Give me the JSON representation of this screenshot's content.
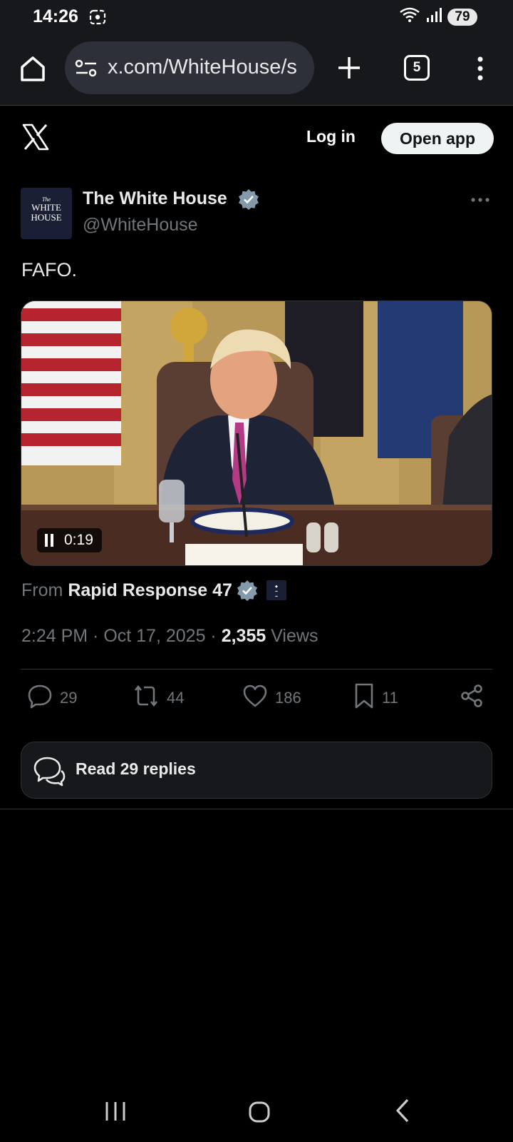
{
  "status_bar": {
    "time": "14:26",
    "battery": "79",
    "icons": [
      "screen-recorder-icon",
      "wifi-icon",
      "signal-icon"
    ]
  },
  "browser": {
    "url": "x.com/WhiteHouse/s",
    "tab_count": "5",
    "icons": [
      "home-icon",
      "site-settings-icon",
      "new-tab-icon",
      "tabs-icon",
      "overflow-menu-icon"
    ]
  },
  "header": {
    "login": "Log in",
    "open_app": "Open app"
  },
  "tweet": {
    "author_name": "The White House",
    "author_handle": "@WhiteHouse",
    "avatar_lines": [
      "The",
      "WHITE",
      "HOUSE"
    ],
    "text": "FAFO.",
    "video": {
      "time": "0:19",
      "state": "playing"
    },
    "from_label": "From",
    "from_source": "Rapid Response 47",
    "timestamp": "2:24 PM · Oct 17, 2025 · ",
    "views_count": "2,355",
    "views_label": " Views",
    "stats": {
      "replies": "29",
      "reposts": "44",
      "likes": "186",
      "bookmarks": "11"
    }
  },
  "read_replies": "Read 29 replies",
  "colors": {
    "background": "#000000",
    "chrome": "#17181c",
    "verified": "#829aab",
    "muted_text": "#71767b",
    "primary_text": "#e7e9ea"
  }
}
